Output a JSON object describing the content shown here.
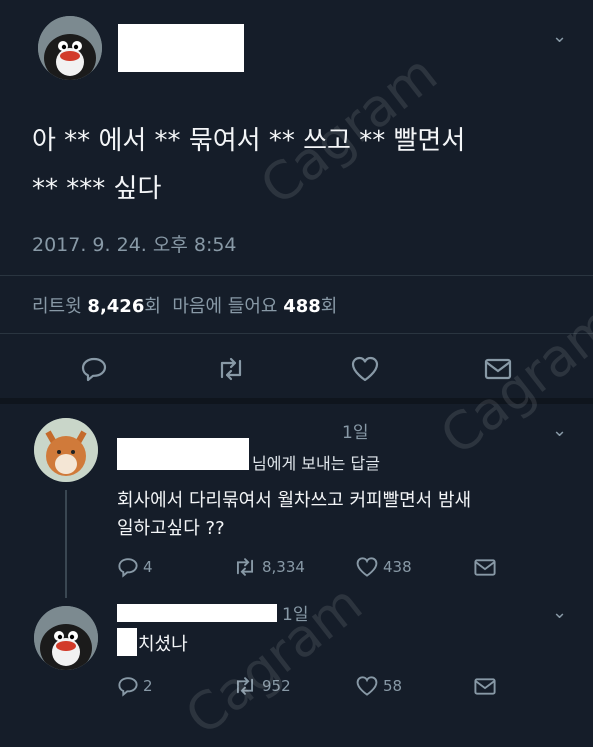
{
  "main_tweet": {
    "text_line1": "아 ** 에서 ** 묶여서 ** 쓰고 ** 빨면서",
    "text_line2": "** *** 싶다",
    "timestamp": "2017. 9. 24. 오후 8:54",
    "retweets_label": "리트윗",
    "retweets_count": "8,426",
    "retweets_suffix": "회",
    "likes_label": "마음에 들어요",
    "likes_count": "488",
    "likes_suffix": "회"
  },
  "reply1": {
    "time": "1일",
    "replying_to_suffix": "님에게 보내는 답글",
    "text_line1": "회사에서 다리묶여서 월차쓰고 커피빨면서 밤새",
    "text_line2": "일하고싶다 ??",
    "replies": "4",
    "retweets": "8,334",
    "likes": "438"
  },
  "reply2": {
    "time": "1일",
    "text": "치셨나",
    "replies": "2",
    "retweets": "952",
    "likes": "58"
  },
  "watermark": "Cagram",
  "icons": [
    "chevron-down-icon",
    "reply-icon",
    "retweet-icon",
    "heart-icon",
    "message-icon"
  ]
}
